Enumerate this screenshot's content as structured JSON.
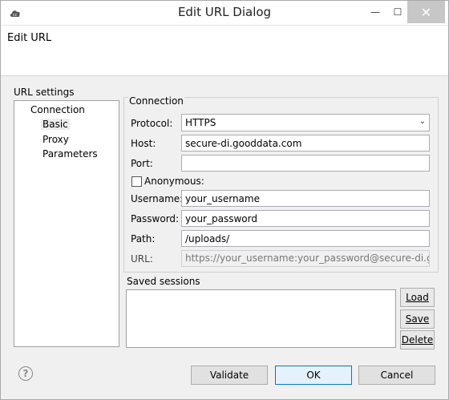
{
  "window": {
    "title": "Edit URL Dialog",
    "controls": {
      "minimize": "—",
      "maximize": "☐",
      "close": "✕"
    }
  },
  "banner": {
    "title": "Edit URL"
  },
  "settings": {
    "label": "URL settings",
    "tree": [
      {
        "label": "Connection"
      },
      {
        "label": "Basic"
      },
      {
        "label": "Proxy"
      },
      {
        "label": "Parameters"
      }
    ]
  },
  "connection": {
    "legend": "Connection",
    "protocol": {
      "label": "Protocol:",
      "value": "HTTPS"
    },
    "host": {
      "label": "Host:",
      "value": "secure-di.gooddata.com"
    },
    "port": {
      "label": "Port:",
      "value": ""
    },
    "anonymous": {
      "label": "Anonymous:",
      "checked": false
    },
    "username": {
      "label": "Username:",
      "value": "your_username"
    },
    "password": {
      "label": "Password:",
      "value": "your_password"
    },
    "path": {
      "label": "Path:",
      "value": "/uploads/"
    },
    "url": {
      "label": "URL:",
      "value": "https://your_username:your_password@secure-di.gooddata.com/uploads/"
    }
  },
  "sessions": {
    "label": "Saved sessions",
    "buttons": {
      "load": "Load",
      "save": "Save",
      "delete": "Delete"
    }
  },
  "footer": {
    "help": "?",
    "validate": "Validate",
    "ok": "OK",
    "cancel": "Cancel"
  },
  "colors": {
    "accent": "#0078d7",
    "close_button": "#c7c7c7"
  },
  "icons": [
    "cloud-app-icon",
    "chevron-down-icon",
    "help-icon"
  ]
}
